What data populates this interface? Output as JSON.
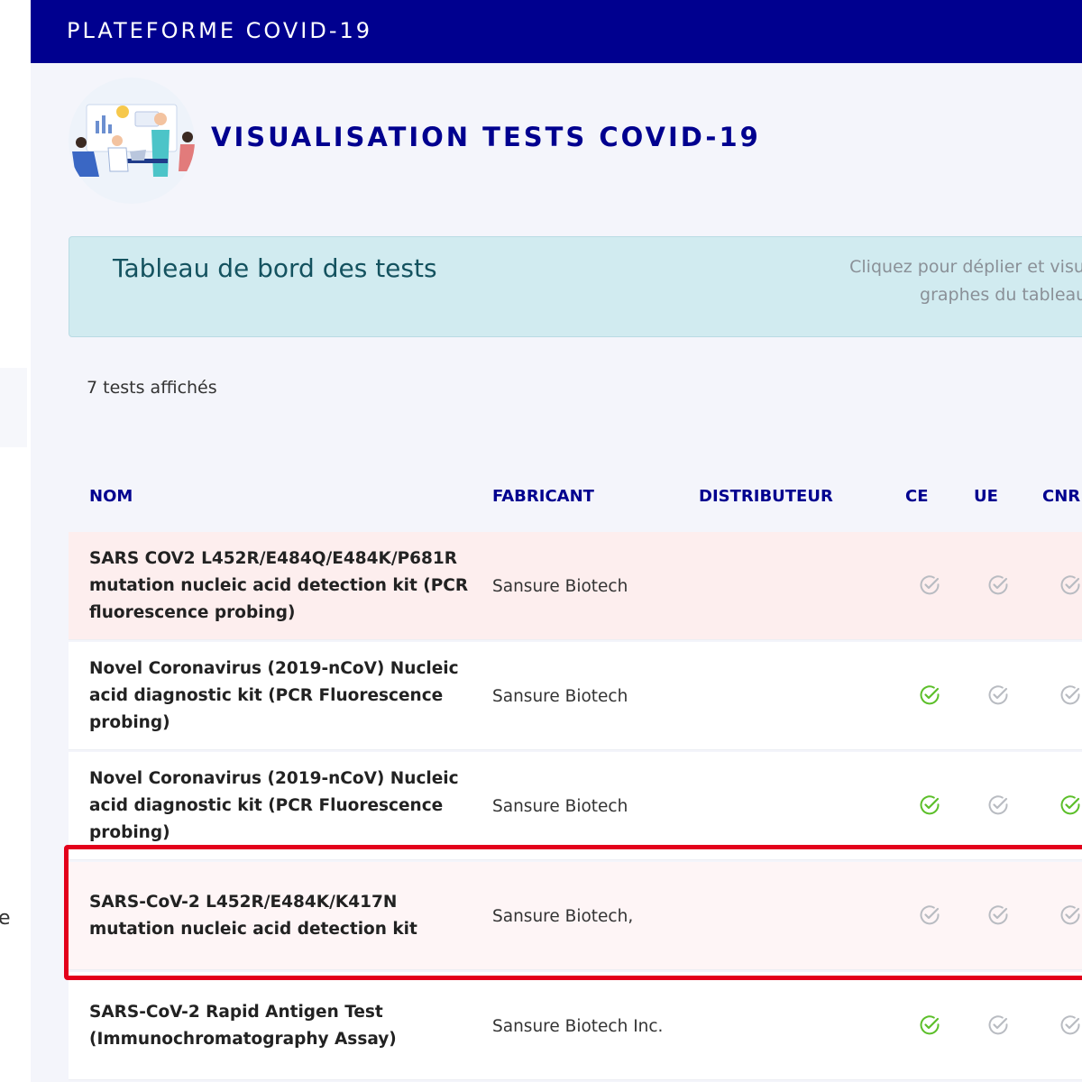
{
  "topbar": {
    "brand": "PLATEFORME COVID-19"
  },
  "header": {
    "title": "VISUALISATION TESTS COVID-19"
  },
  "dashboard": {
    "title": "Tableau de bord des tests",
    "hint": "Cliquez pour déplier et visualis\ngraphes du tableau de"
  },
  "count_label": "7 tests affichés",
  "table": {
    "columns": [
      "NOM",
      "FABRICANT",
      "DISTRIBUTEUR",
      "CE",
      "UE",
      "CNR"
    ],
    "rows": [
      {
        "name": "SARS COV2 L452R/E484Q/E484K/P681R mutation nucleic acid detection kit (PCR fluorescence probing)",
        "maker": "Sansure Biotech",
        "distributor": "",
        "ce": false,
        "ue": false,
        "cnr": false
      },
      {
        "name": "Novel Coronavirus (2019-nCoV) Nucleic acid diagnostic kit (PCR Fluorescence probing)",
        "maker": "Sansure Biotech",
        "distributor": "",
        "ce": true,
        "ue": false,
        "cnr": false
      },
      {
        "name": "Novel Coronavirus (2019-nCoV) Nucleic acid diagnostic kit (PCR Fluorescence probing)",
        "maker": "Sansure Biotech",
        "distributor": "",
        "ce": true,
        "ue": false,
        "cnr": true
      },
      {
        "name": "SARS-CoV-2 L452R/E484K/K417N mutation nucleic acid detection kit",
        "maker": "Sansure Biotech,",
        "distributor": "",
        "ce": false,
        "ue": false,
        "cnr": false
      },
      {
        "name": "SARS-CoV-2 Rapid Antigen Test (Immunochromatography Assay)",
        "maker": "Sansure Biotech Inc.",
        "distributor": "",
        "ce": true,
        "ue": false,
        "cnr": false
      }
    ]
  },
  "colors": {
    "brand_blue": "#00008f",
    "check_on": "#5cbf2a",
    "check_off": "#b9bcc2",
    "highlight": "#e3001b"
  },
  "icons": {
    "check": "check-circle-icon",
    "illustration": "team-meeting-illustration"
  },
  "left_edge_text": "e"
}
